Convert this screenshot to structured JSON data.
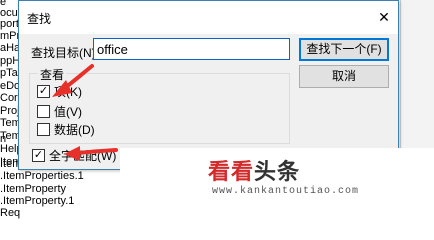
{
  "background_tree": {
    "items": [
      "e",
      "ocumentHandler",
      "port",
      "mPr",
      "aHa",
      "ppH",
      "pTal",
      "eDo",
      "Cor",
      "Proj",
      "Tem",
      "Tem",
      "n",
      "Help",
      "Item",
      "ItemProperties",
      ".ItemProperties.1",
      ".ItemProperty",
      ".ItemProperty.1",
      "Req"
    ]
  },
  "dialog": {
    "title": "查找",
    "close_glyph": "✕",
    "find_label": "查找目标(N):",
    "find_value": "office",
    "find_next_label": "查找下一个(F)",
    "cancel_label": "取消",
    "look_in_label": "查看",
    "options": [
      {
        "label": "项(K)",
        "checked": true
      },
      {
        "label": "值(V)",
        "checked": false
      },
      {
        "label": "数据(D)",
        "checked": false
      }
    ],
    "whole_match_label": "全字匹配(W)",
    "whole_match_checked": true
  },
  "watermark": {
    "title_part1": "看看",
    "title_part2": "头条",
    "url": "www.kankantoutiao.com"
  },
  "colors": {
    "arrow": "#e8302a",
    "dialog_border": "#3c7fb1",
    "focus_blue": "#0078d7"
  }
}
